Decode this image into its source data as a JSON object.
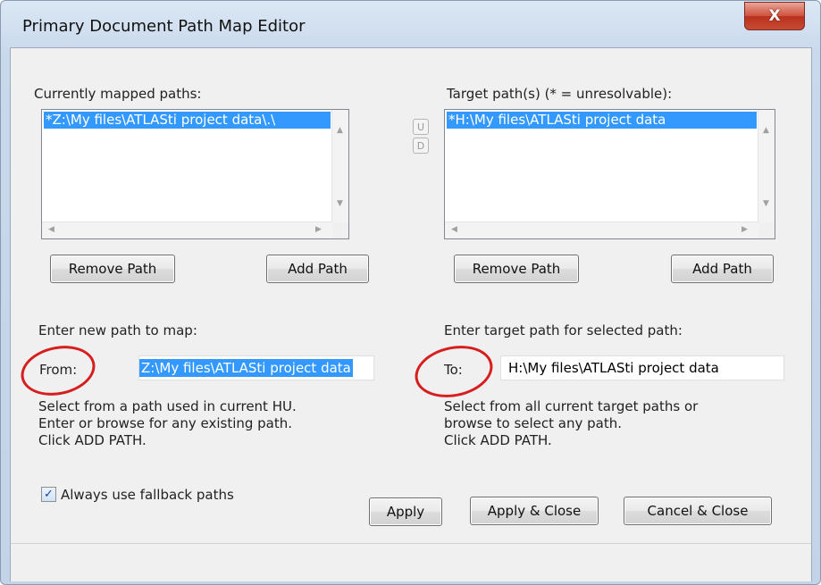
{
  "window": {
    "title": "Primary Document Path Map Editor",
    "close_glyph": "X"
  },
  "left": {
    "list_label": "Currently mapped paths:",
    "list_items": [
      "*Z:\\My files\\ATLASti project data\\.\\"
    ],
    "remove_label": "Remove Path",
    "add_label": "Add Path",
    "entry_label": "Enter new path to map:",
    "field_label": "From:",
    "field_value": "Z:\\My files\\ATLASti project data",
    "help": [
      "Select from a path used in current HU.",
      "Enter or browse for any existing path.",
      "Click ADD PATH."
    ]
  },
  "right": {
    "list_label": "Target path(s) (* = unresolvable):",
    "list_items": [
      "*H:\\My files\\ATLASti project data"
    ],
    "remove_label": "Remove Path",
    "add_label": "Add Path",
    "entry_label": "Enter target path for selected path:",
    "field_label": "To:",
    "field_value": "H:\\My files\\ATLASti project data",
    "help": [
      "Select from all current target paths or",
      "browse to select any path.",
      "Click ADD PATH."
    ]
  },
  "updown": {
    "up": "U",
    "down": "D"
  },
  "fallback": {
    "label": "Always use fallback paths",
    "checked": true
  },
  "footer": {
    "apply": "Apply",
    "apply_close": "Apply & Close",
    "cancel_close": "Cancel & Close"
  }
}
